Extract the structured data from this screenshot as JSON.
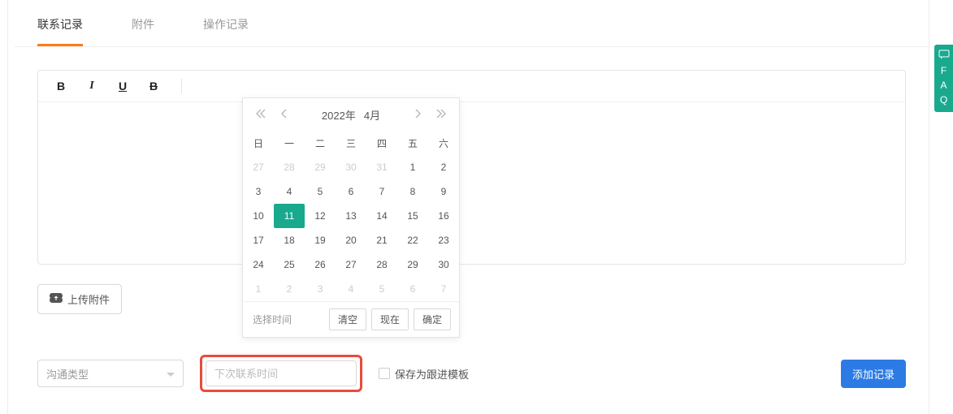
{
  "tabs": {
    "contact": "联系记录",
    "attachment": "附件",
    "operation": "操作记录"
  },
  "upload_label": "上传附件",
  "select_placeholder": "沟通类型",
  "date_placeholder": "下次联系时间",
  "save_template_label": "保存为跟进模板",
  "add_record_label": "添加记录",
  "calendar": {
    "year_label": "2022年",
    "month_label": "4月",
    "time_label": "选择时间",
    "clear_label": "清空",
    "now_label": "现在",
    "ok_label": "确定",
    "weekdays": [
      "日",
      "一",
      "二",
      "三",
      "四",
      "五",
      "六"
    ],
    "weeks": [
      [
        {
          "n": "27",
          "o": true
        },
        {
          "n": "28",
          "o": true
        },
        {
          "n": "29",
          "o": true
        },
        {
          "n": "30",
          "o": true
        },
        {
          "n": "31",
          "o": true
        },
        {
          "n": "1"
        },
        {
          "n": "2"
        }
      ],
      [
        {
          "n": "3"
        },
        {
          "n": "4"
        },
        {
          "n": "5"
        },
        {
          "n": "6"
        },
        {
          "n": "7"
        },
        {
          "n": "8"
        },
        {
          "n": "9"
        }
      ],
      [
        {
          "n": "10"
        },
        {
          "n": "11",
          "sel": true
        },
        {
          "n": "12"
        },
        {
          "n": "13"
        },
        {
          "n": "14"
        },
        {
          "n": "15"
        },
        {
          "n": "16"
        }
      ],
      [
        {
          "n": "17"
        },
        {
          "n": "18"
        },
        {
          "n": "19"
        },
        {
          "n": "20"
        },
        {
          "n": "21"
        },
        {
          "n": "22"
        },
        {
          "n": "23"
        }
      ],
      [
        {
          "n": "24"
        },
        {
          "n": "25"
        },
        {
          "n": "26"
        },
        {
          "n": "27"
        },
        {
          "n": "28"
        },
        {
          "n": "29"
        },
        {
          "n": "30"
        }
      ],
      [
        {
          "n": "1",
          "o": true
        },
        {
          "n": "2",
          "o": true
        },
        {
          "n": "3",
          "o": true
        },
        {
          "n": "4",
          "o": true
        },
        {
          "n": "5",
          "o": true
        },
        {
          "n": "6",
          "o": true
        },
        {
          "n": "7",
          "o": true
        }
      ]
    ]
  },
  "faq": {
    "letters": [
      "F",
      "A",
      "Q"
    ]
  }
}
